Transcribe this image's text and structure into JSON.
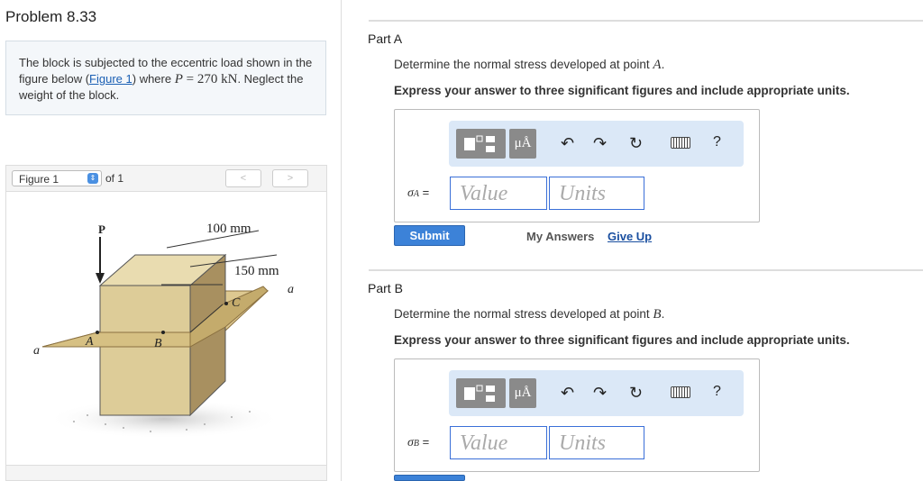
{
  "problem": {
    "title": "Problem 8.33",
    "statement_pre": "The block is subjected to the eccentric load shown in the figure below (",
    "figure_link": "Figure 1",
    "statement_mid": ") where ",
    "P_symbol": "P",
    "P_value": " = 270 kN",
    "statement_post": ". Neglect the weight of the block."
  },
  "figure_nav": {
    "selected": "Figure 1",
    "of_label": "of 1",
    "prev": "<",
    "next": ">"
  },
  "figure": {
    "label_P": "P",
    "dim_100": "100 mm",
    "dim_150": "150 mm",
    "label_a_left": "a",
    "label_a_right": "a",
    "label_A": "A",
    "label_B": "B",
    "label_C": "C"
  },
  "toolbar": {
    "units_symbol": "μÅ",
    "undo_icon": "↶",
    "redo_icon": "↷",
    "reset_icon": "↻",
    "help": "?"
  },
  "part_a": {
    "title": "Part A",
    "question_pre": "Determine the normal stress developed at point ",
    "point": "A",
    "question_post": ".",
    "instruction": "Express your answer to three significant figures and include appropriate units.",
    "sigma": "σ",
    "sub": "A",
    "eq": " =",
    "value_placeholder": "Value",
    "units_placeholder": "Units",
    "submit": "Submit",
    "my_answers": "My Answers",
    "give_up": "Give Up"
  },
  "part_b": {
    "title": "Part B",
    "question_pre": "Determine the normal stress developed at point ",
    "point": "B",
    "question_post": ".",
    "instruction": "Express your answer to three significant figures and include appropriate units.",
    "sigma": "σ",
    "sub": "B",
    "eq": " =",
    "value_placeholder": "Value",
    "units_placeholder": "Units"
  }
}
